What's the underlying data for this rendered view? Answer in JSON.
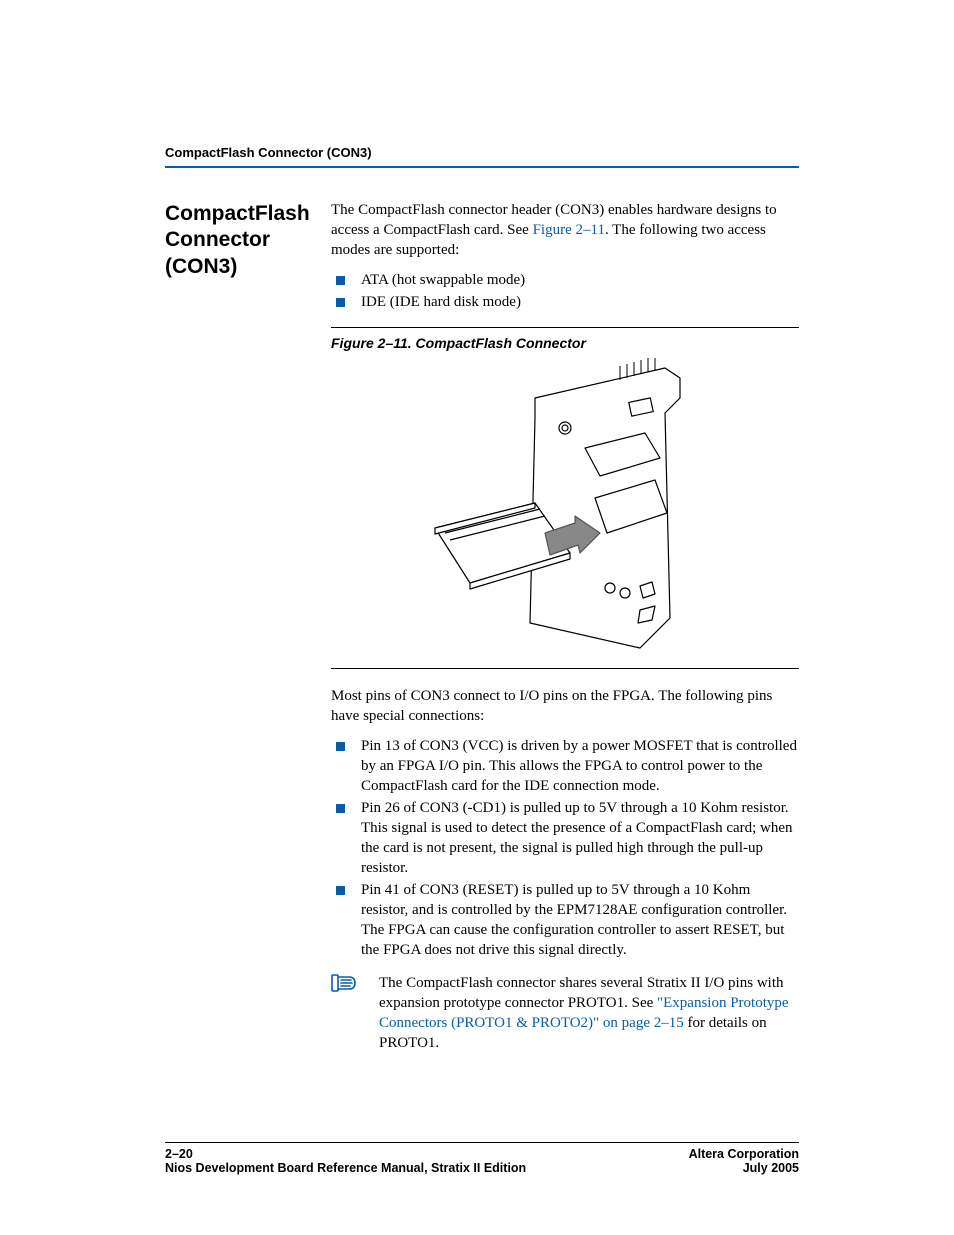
{
  "runningHead": "CompactFlash Connector (CON3)",
  "sideHeading": "CompactFlash Connector (CON3)",
  "intro": {
    "pre": "The CompactFlash connector header (CON3) enables hardware designs to access a CompactFlash card. See ",
    "link": "Figure 2–11",
    "post": ". The following two access modes are supported:"
  },
  "modes": [
    "ATA (hot swappable mode)",
    "IDE (IDE hard disk mode)"
  ],
  "figureCaption": "Figure 2–11. CompactFlash Connector",
  "para2": "Most pins of CON3 connect to I/O pins on the FPGA. The following pins have special connections:",
  "pins": [
    "Pin 13 of CON3 (VCC) is driven by a power MOSFET that is controlled by an FPGA I/O pin. This allows the FPGA to control power to the CompactFlash card for the IDE connection mode.",
    "Pin 26 of CON3 (-CD1) is pulled up to 5V through a 10 Kohm resistor. This signal is used to detect the presence of a CompactFlash card; when the card is not present, the signal is pulled high through the pull-up resistor.",
    "Pin 41 of CON3 (RESET) is pulled up to 5V through a 10 Kohm resistor, and is controlled by the EPM7128AE configuration controller. The FPGA can cause the configuration controller to assert RESET, but the FPGA does not drive this signal directly."
  ],
  "note": {
    "pre": "The CompactFlash connector shares several Stratix II I/O pins with expansion prototype connector PROTO1. See ",
    "link": "\"Expansion Prototype Connectors (PROTO1 & PROTO2)\" on page 2–15",
    "post": " for details on PROTO1."
  },
  "footer": {
    "leftTop": "2–20",
    "leftBottom": "Nios Development Board Reference Manual, Stratix II Edition",
    "rightTop": "Altera Corporation",
    "rightBottom": "July 2005"
  }
}
